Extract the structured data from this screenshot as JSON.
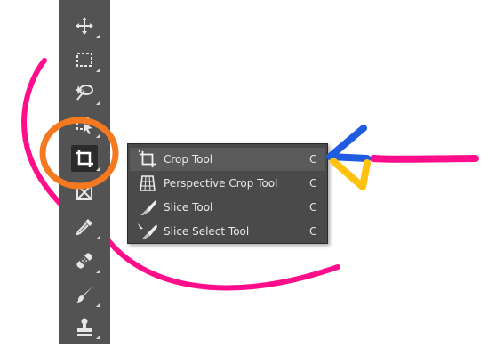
{
  "toolbar": {
    "tools": [
      {
        "name": "move-tool",
        "icon": "move-icon"
      },
      {
        "name": "marquee-tool",
        "icon": "marquee-icon"
      },
      {
        "name": "lasso-tool",
        "icon": "magic-lasso-icon"
      },
      {
        "name": "object-selection-tool",
        "icon": "object-selection-icon"
      },
      {
        "name": "crop-tool",
        "icon": "crop-icon"
      },
      {
        "name": "frame-tool",
        "icon": "frame-icon"
      },
      {
        "name": "eyedropper-tool",
        "icon": "eyedropper-icon"
      },
      {
        "name": "healing-brush-tool",
        "icon": "bandage-icon"
      },
      {
        "name": "brush-tool",
        "icon": "brush-icon"
      },
      {
        "name": "stamp-tool",
        "icon": "stamp-icon"
      }
    ]
  },
  "flyout": {
    "items": [
      {
        "label": "Crop Tool",
        "shortcut": "C",
        "icon": "crop-icon"
      },
      {
        "label": "Perspective Crop Tool",
        "shortcut": "C",
        "icon": "perspective-crop-icon"
      },
      {
        "label": "Slice Tool",
        "shortcut": "C",
        "icon": "slice-icon"
      },
      {
        "label": "Slice Select Tool",
        "shortcut": "C",
        "icon": "slice-select-icon"
      }
    ]
  },
  "colors": {
    "panel": "#535353",
    "highlight_circle": "#f47920",
    "annotation_magenta": "#ff0d8a",
    "arrow_blue": "#1f5ce0",
    "arrow_yellow": "#ffc20e"
  }
}
